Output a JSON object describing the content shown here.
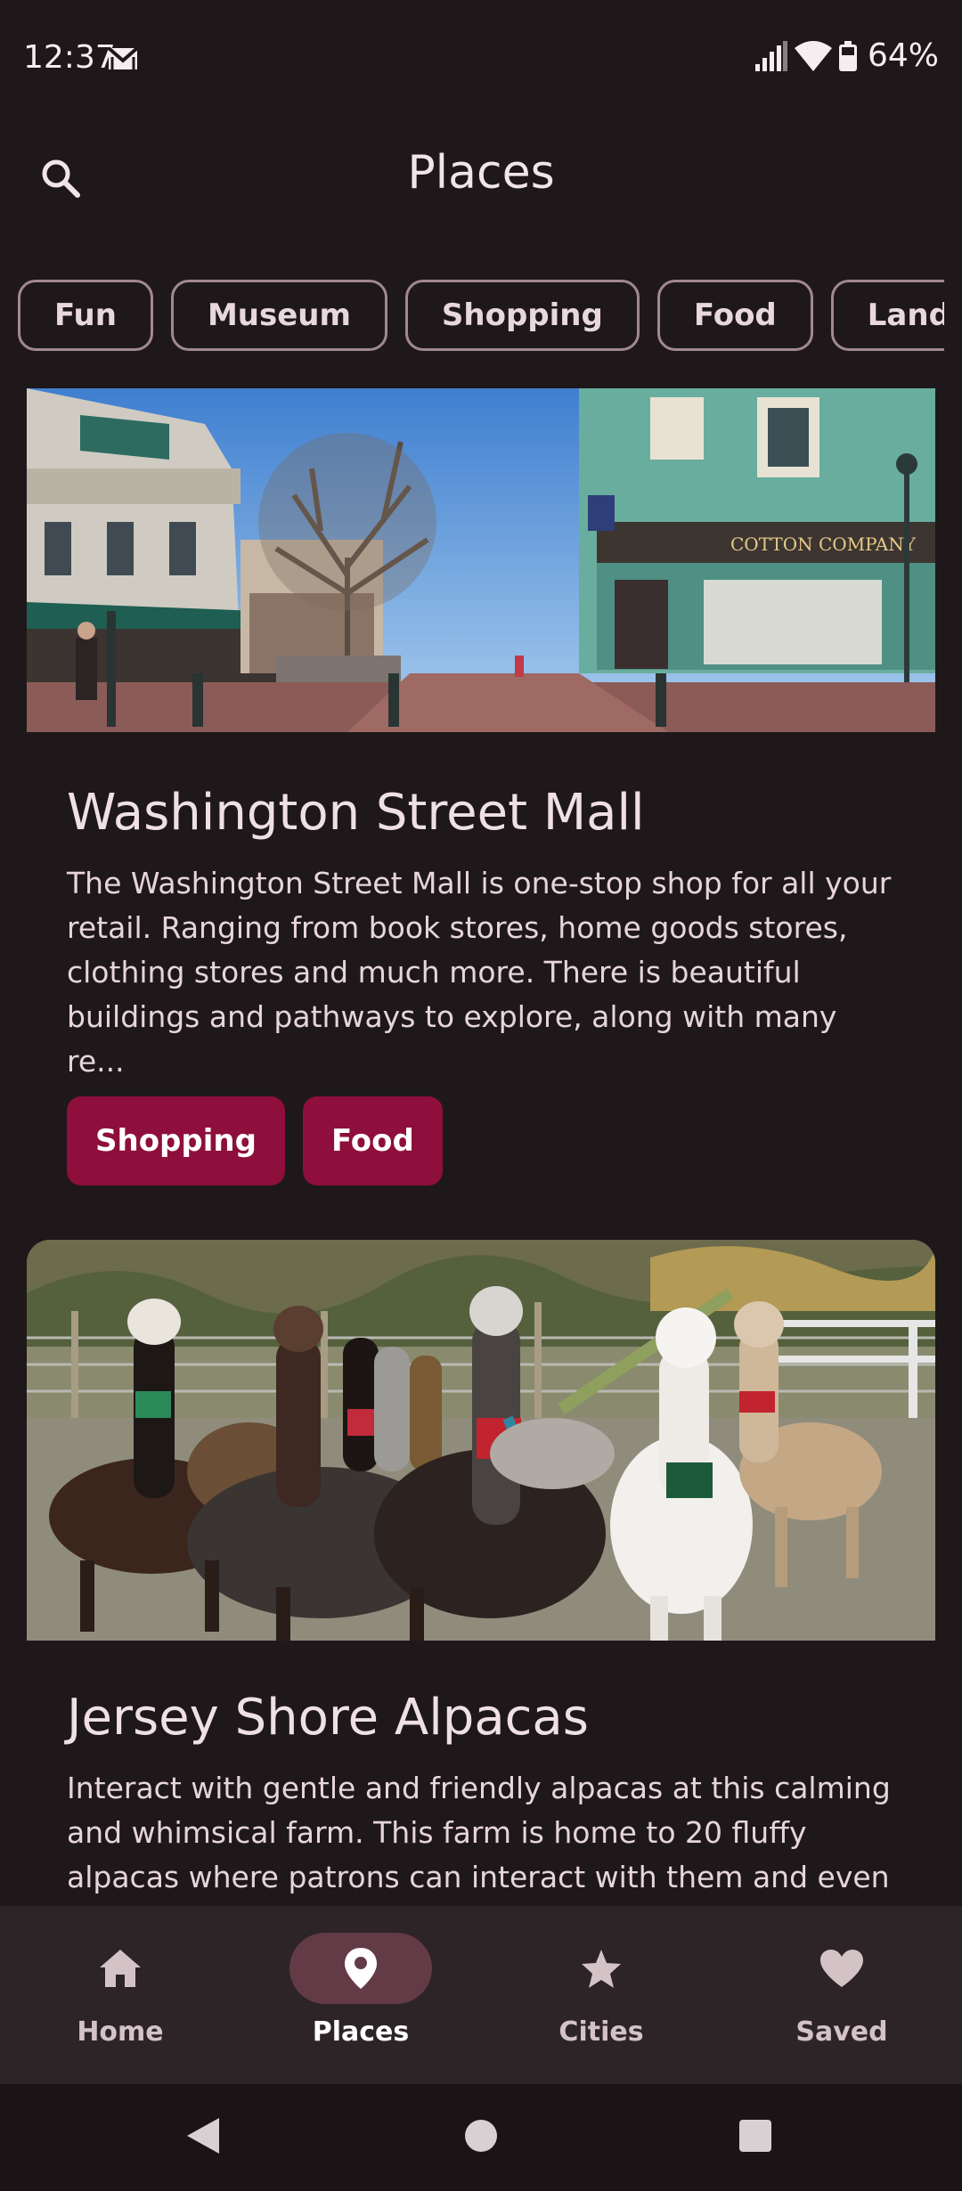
{
  "status_bar": {
    "time": "12:37",
    "battery": "64%"
  },
  "app_bar": {
    "title": "Places",
    "search_icon": "search-icon"
  },
  "filters": [
    "Fun",
    "Museum",
    "Shopping",
    "Food",
    "Landma"
  ],
  "places": [
    {
      "title": "Washington Street Mall",
      "description": "The Washington Street Mall is one-stop shop for all your retail. Ranging from book stores, home goods stores, clothing stores and much more. There is beautiful buildings and pathways to explore, along with many re...",
      "tags": [
        "Shopping",
        "Food"
      ],
      "image_signage": "COTTON COMPANY"
    },
    {
      "title": "Jersey Shore Alpacas",
      "description": "Interact with gentle and friendly alpacas at this calming and whimsical farm. This farm is home to 20 fluffy alpacas where patrons can interact with them and even"
    }
  ],
  "bottom_nav": [
    {
      "label": "Home",
      "icon": "home-icon"
    },
    {
      "label": "Places",
      "icon": "place-icon"
    },
    {
      "label": "Cities",
      "icon": "star-icon"
    },
    {
      "label": "Saved",
      "icon": "heart-icon"
    }
  ],
  "colors": {
    "background": "#1e181a",
    "tag": "#8e0e3c",
    "nav_bar": "#2d2427",
    "active_pill": "#633b46"
  }
}
